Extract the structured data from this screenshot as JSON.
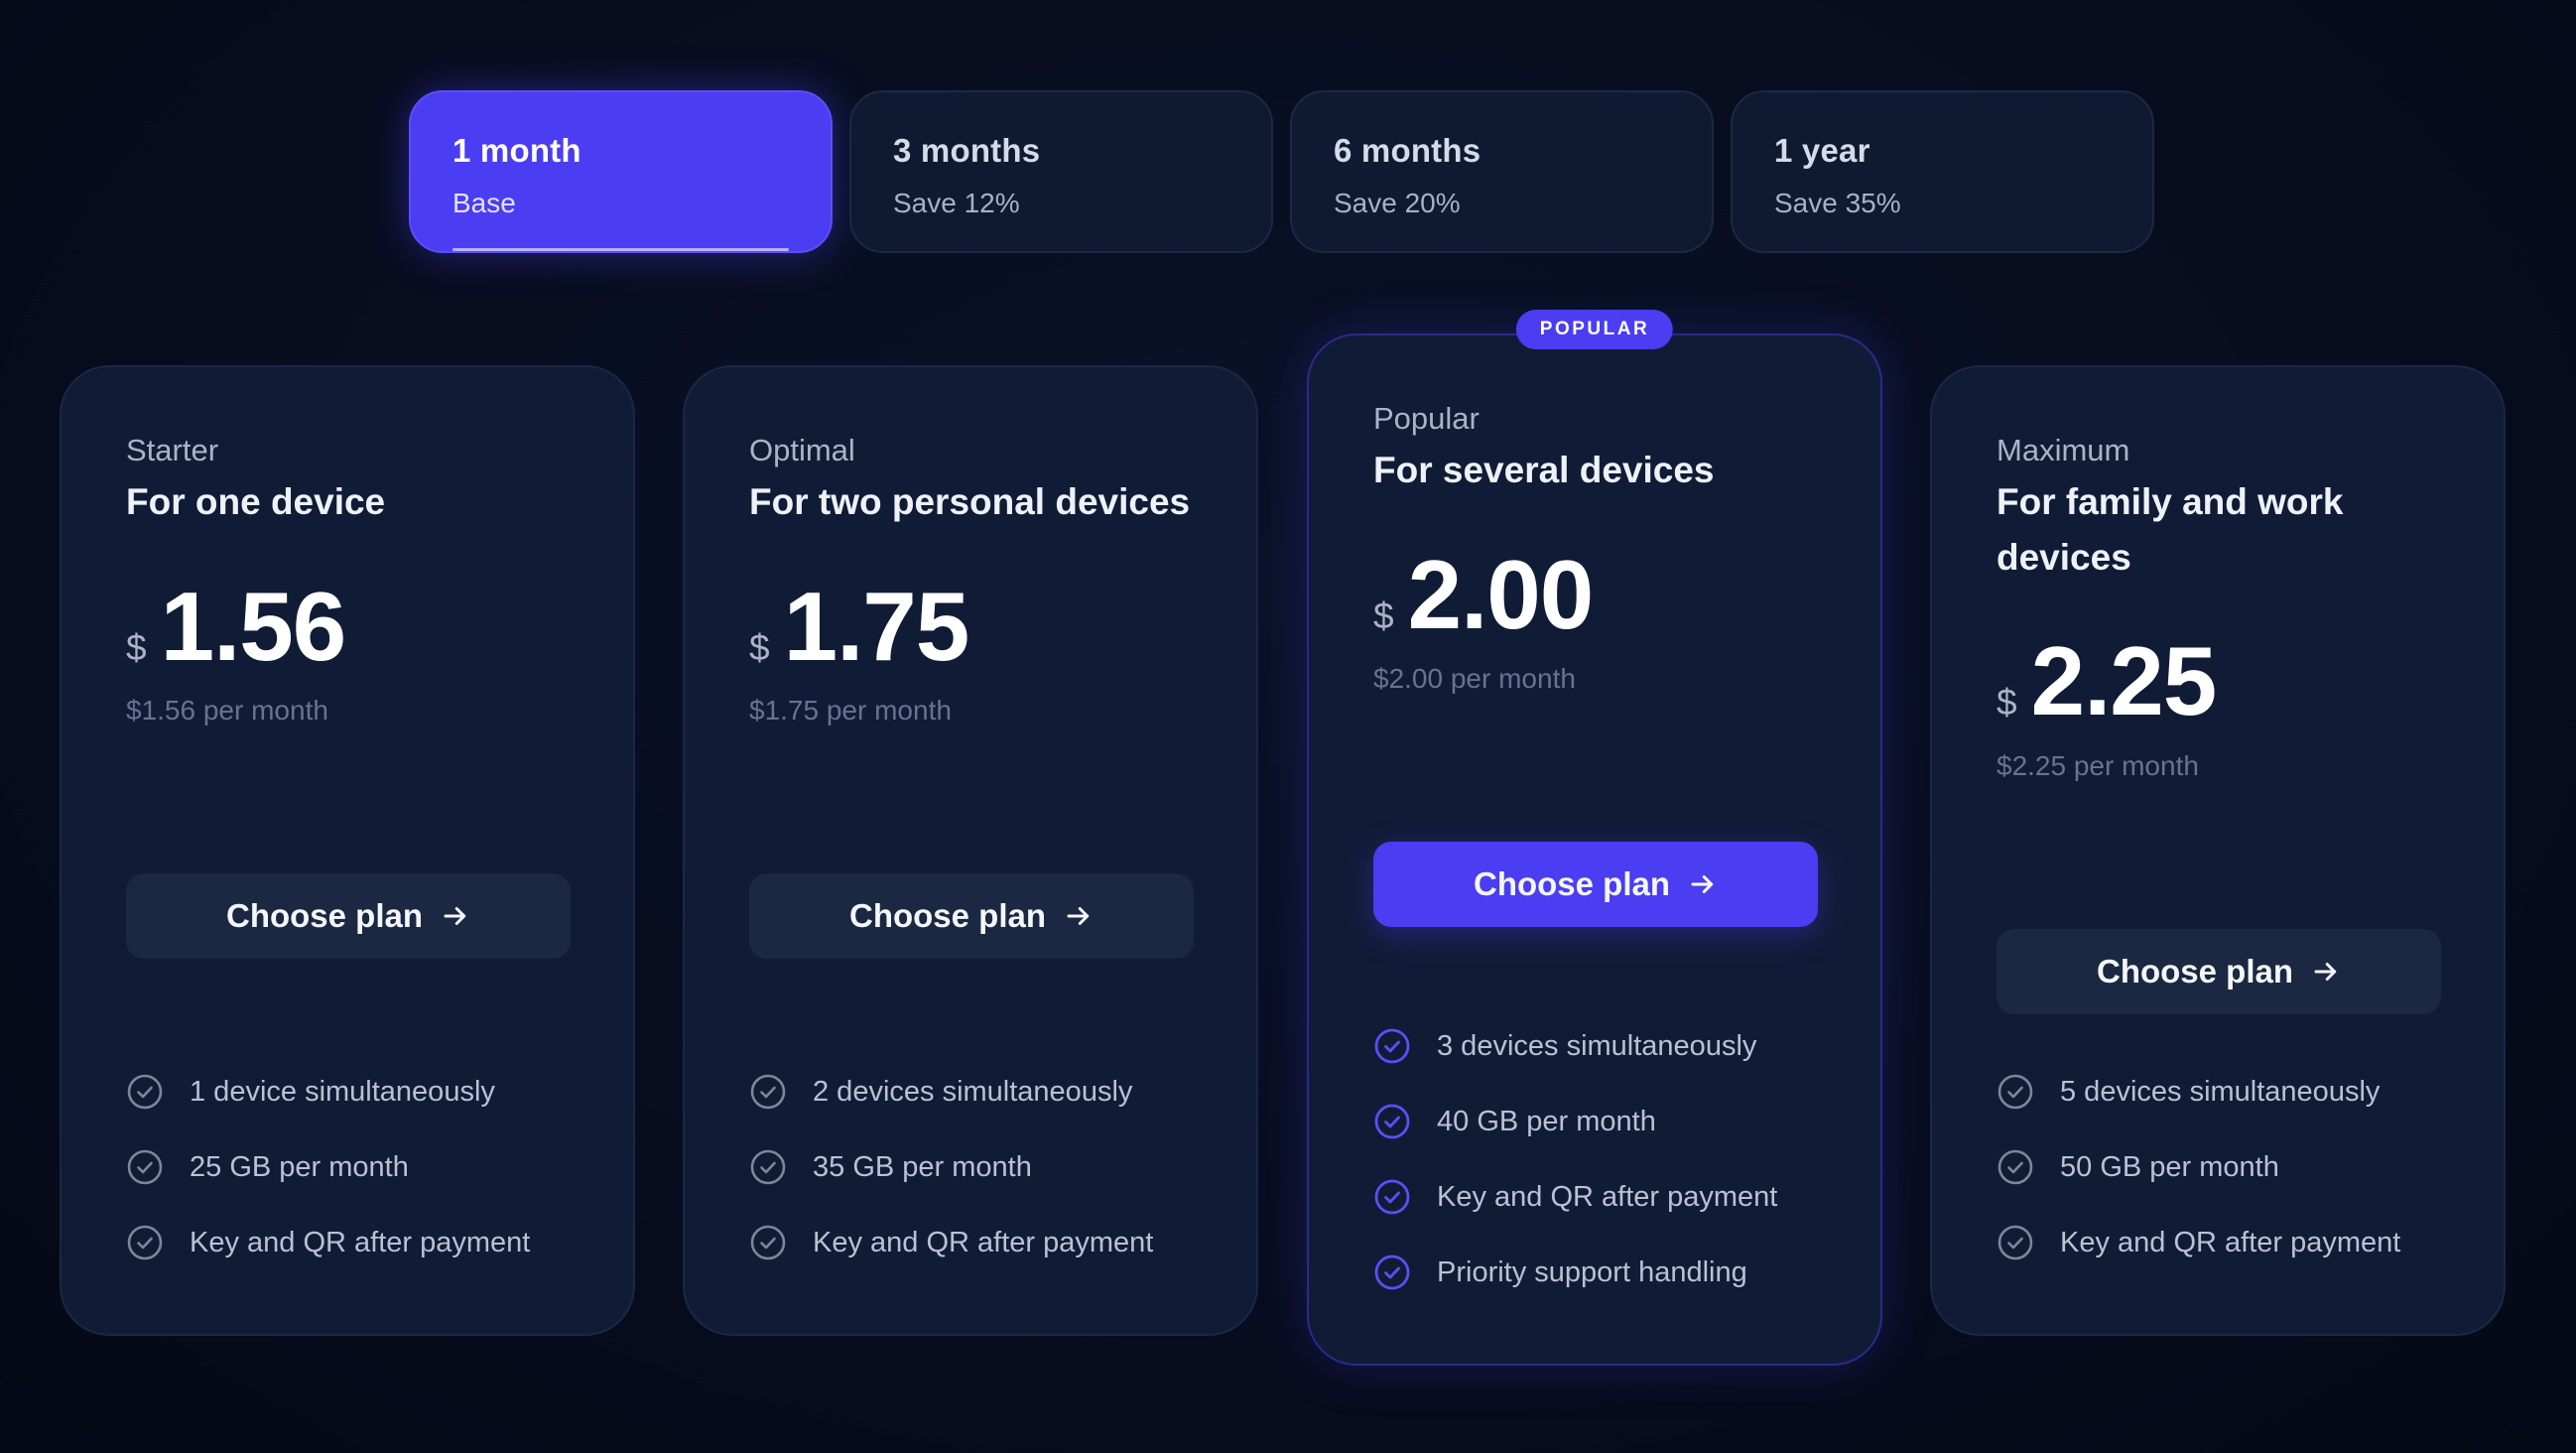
{
  "tabs": [
    {
      "title": "1 month",
      "subtitle": "Base",
      "active": true
    },
    {
      "title": "3 months",
      "subtitle": "Save 12%",
      "active": false
    },
    {
      "title": "6 months",
      "subtitle": "Save 20%",
      "active": false
    },
    {
      "title": "1 year",
      "subtitle": "Save 35%",
      "active": false
    }
  ],
  "plans": [
    {
      "kicker": "Starter",
      "heading": "For one device",
      "currency": "$",
      "price": "1.56",
      "per_month": "$1.56 per month",
      "button_label": "Choose plan",
      "features": [
        "1 device simultaneously",
        "25 GB per month",
        "Key and QR after payment"
      ]
    },
    {
      "kicker": "Optimal",
      "heading": "For two personal devices",
      "currency": "$",
      "price": "1.75",
      "per_month": "$1.75 per month",
      "button_label": "Choose plan",
      "features": [
        "2 devices simultaneously",
        "35 GB per month",
        "Key and QR after payment"
      ]
    },
    {
      "kicker": "Popular",
      "heading": "For several devices",
      "currency": "$",
      "price": "2.00",
      "per_month": "$2.00 per month",
      "button_label": "Choose plan",
      "badge": "POPULAR",
      "features": [
        "3 devices simultaneously",
        "40 GB per month",
        "Key and QR after payment",
        "Priority support handling"
      ]
    },
    {
      "kicker": "Maximum",
      "heading": "For family and work devices",
      "currency": "$",
      "price": "2.25",
      "per_month": "$2.25 per month",
      "button_label": "Choose plan",
      "features": [
        "5 devices simultaneously",
        "50 GB per month",
        "Key and QR after payment"
      ]
    }
  ],
  "colors": {
    "accent": "#4a3df2",
    "background": "#070c1d",
    "card": "#101c36",
    "check_default": "#7c869c",
    "check_featured": "#5b4ff7"
  },
  "icons": {
    "button_arrow": "arrow-right-icon",
    "feature_check": "check-circle-icon"
  }
}
